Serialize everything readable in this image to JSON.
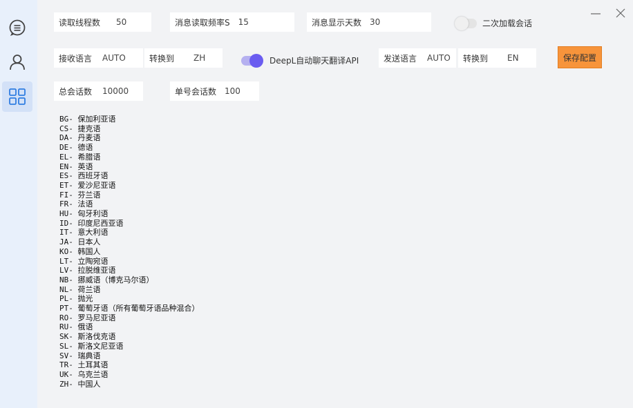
{
  "settings": {
    "thread_count": {
      "label": "读取线程数",
      "value": "50"
    },
    "read_frequency": {
      "label": "消息读取频率S",
      "value": "15"
    },
    "display_days": {
      "label": "消息显示天数",
      "value": "30"
    },
    "secondary_load": {
      "label": "二次加载会话",
      "checked": false
    },
    "receive_language": {
      "label": "接收语言",
      "value": "AUTO"
    },
    "receive_convert": {
      "label": "转换到",
      "value": "ZH"
    },
    "deepl_auto": {
      "label": "DeepL自动聊天翻译API",
      "checked": true
    },
    "send_language": {
      "label": "发送语言",
      "value": "AUTO"
    },
    "send_convert": {
      "label": "转换到",
      "value": "EN"
    },
    "total_sessions": {
      "label": "总会话数",
      "value": "10000"
    },
    "single_sessions": {
      "label": "单号会话数",
      "value": "100"
    }
  },
  "save_button": "保存配置",
  "colors": {
    "accent_orange": "#f7943b",
    "toggle_on": "#6a5cf0",
    "sidebar_active": "#d3e1f7"
  },
  "sidebar": [
    {
      "icon": "chat-bubble-icon"
    },
    {
      "icon": "user-icon"
    },
    {
      "icon": "grid-apps-icon",
      "active": true
    }
  ],
  "languages": [
    {
      "code": "BG-",
      "name": "保加利亚语"
    },
    {
      "code": "CS-",
      "name": "捷克语"
    },
    {
      "code": "DA-",
      "name": "丹麦语"
    },
    {
      "code": "DE-",
      "name": "德语"
    },
    {
      "code": "EL-",
      "name": "希腊语"
    },
    {
      "code": "EN-",
      "name": "英语"
    },
    {
      "code": "ES-",
      "name": "西班牙语"
    },
    {
      "code": "ET-",
      "name": "爱沙尼亚语"
    },
    {
      "code": "FI-",
      "name": "芬兰语"
    },
    {
      "code": "FR-",
      "name": "法语"
    },
    {
      "code": "HU-",
      "name": "匈牙利语"
    },
    {
      "code": "ID-",
      "name": "印度尼西亚语"
    },
    {
      "code": "IT-",
      "name": "意大利语"
    },
    {
      "code": "JA-",
      "name": "日本人"
    },
    {
      "code": "KO-",
      "name": "韩国人"
    },
    {
      "code": "LT-",
      "name": "立陶宛语"
    },
    {
      "code": "LV-",
      "name": "拉脱维亚语"
    },
    {
      "code": "NB-",
      "name": "挪威语（博克马尔语）"
    },
    {
      "code": "NL-",
      "name": "荷兰语"
    },
    {
      "code": "PL-",
      "name": "抛光"
    },
    {
      "code": "PT-",
      "name": "葡萄牙语（所有葡萄牙语品种混合）"
    },
    {
      "code": "RO-",
      "name": "罗马尼亚语"
    },
    {
      "code": "RU-",
      "name": "俄语"
    },
    {
      "code": "SK-",
      "name": "斯洛伐克语"
    },
    {
      "code": "SL-",
      "name": "斯洛文尼亚语"
    },
    {
      "code": "SV-",
      "name": "瑞典语"
    },
    {
      "code": "TR-",
      "name": "土耳其语"
    },
    {
      "code": "UK-",
      "name": "乌克兰语"
    },
    {
      "code": "ZH-",
      "name": "中国人"
    }
  ]
}
